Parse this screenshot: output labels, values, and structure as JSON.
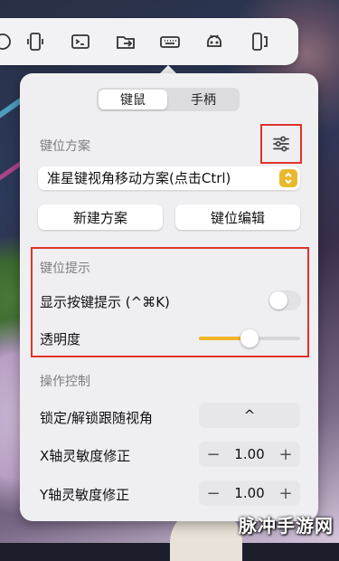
{
  "segment": {
    "keyboard_mouse": "键鼠",
    "gamepad": "手柄"
  },
  "scheme": {
    "section_title": "键位方案",
    "selected": "准星键视角移动方案(点击Ctrl)",
    "new_button": "新建方案",
    "edit_button": "键位编辑"
  },
  "hints": {
    "section_title": "键位提示",
    "show_label": "显示按键提示 (^⌘K)",
    "show_enabled": false,
    "opacity_label": "透明度",
    "opacity_value": 0.5
  },
  "control": {
    "section_title": "操作控制",
    "lock_label": "锁定/解锁跟随视角",
    "lock_key": "^",
    "x_label": "X轴灵敏度修正",
    "x_value": "1.00",
    "y_label": "Y轴灵敏度修正",
    "y_value": "1.00",
    "minus": "−",
    "plus": "+"
  },
  "toolbar_icons": [
    "circle-icon",
    "phone-rotate-icon",
    "terminal-icon",
    "folder-transfer-icon",
    "keyboard-icon",
    "android-icon",
    "screen-rotate-icon"
  ],
  "colors": {
    "accent": "#f0b323",
    "highlight": "#e0332b"
  },
  "watermark": "脉冲手游网"
}
